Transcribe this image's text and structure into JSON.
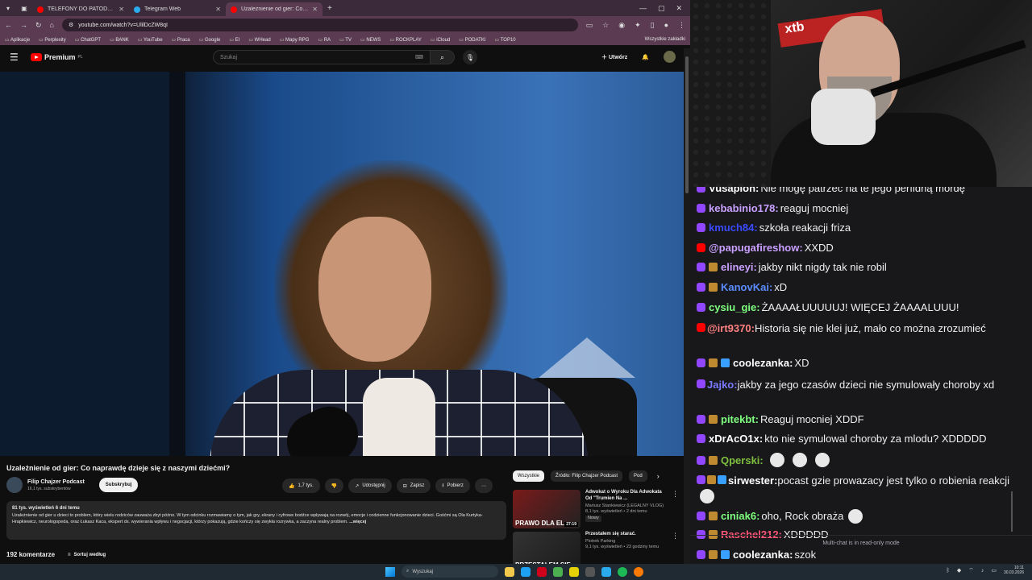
{
  "browser": {
    "tabs": [
      {
        "title": "TELEFONY DO PATODEWELOPE",
        "color": "#ff0000",
        "active": false
      },
      {
        "title": "Telegram Web",
        "color": "#2aabee",
        "active": false
      },
      {
        "title": "Uzależnienie od gier: Co naprawd",
        "color": "#ff0000",
        "active": true
      }
    ],
    "new_tab": "+",
    "url": "youtube.com/watch?v=UlilDcZW8qI",
    "bookmarks": [
      "Aplikacje",
      "Perplexity",
      "ChatGPT",
      "BANK",
      "YouTube",
      "Praca",
      "Google",
      "EI",
      "WHead",
      "Mapy RPG",
      "RA",
      "TV",
      "NEWS",
      "ROCKPLAY",
      "iCloud",
      "PODATKI",
      "TOP10"
    ],
    "all_bookmarks": "Wszystkie zakładki"
  },
  "youtube": {
    "logo": "Premium",
    "logo_sup": "PL",
    "search_placeholder": "Szukaj",
    "create_label": "Utwórz",
    "video_title": "Uzależnienie od gier: Co naprawdę dzieje się z naszymi dziećmi?",
    "channel_name": "Filip Chajzer Podcast",
    "channel_subs": "16,1 tys. subskrybentów",
    "subscribe_label": "Subskrybuj",
    "likes": "1,7 tys.",
    "share_label": "Udostępnij",
    "save_label": "Zapisz",
    "download_label": "Pobierz",
    "desc_meta": "81 tys. wyświetleń  6 dni temu",
    "desc_text": "Uzależnienie od gier u dzieci to problem, który wielu rodziców zauważa zbyt późno. W tym odcinku rozmawiamy o tym, jak gry, ekrany i cyfrowe bodźce wpływają na rozwój, emocje i codzienne funkcjonowanie dzieci. Gośćmi są Ola Kurtyka-Hrapkiewicz, neurologopeda, oraz Łukasz Kaca, ekspert ds. wywierania wpływu i negocjacji, którzy pokazują, gdzie kończy się zwykła rozrywka, a zaczyna realny problem.",
    "desc_more": "...więcej",
    "comments_count": "192 komentarze",
    "sort_label": "Sortuj według",
    "chips": [
      "Wszystkie",
      "Źródło: Filip Chajzer Podcast",
      "Pod"
    ],
    "related": [
      {
        "title": "Adwokat o Wyroku Dla Adwokata Od \"Trumien Na ...",
        "channel": "Mariusz Stankiewicz (LEGALNY VLOG)",
        "meta": "8,1 tys. wyświetleń • 2 dni temu",
        "badge": "Nowy",
        "thumb_text": "PRAWO DLA EL",
        "thumb_time": "27:19"
      },
      {
        "title": "Przestałem się starać.",
        "channel": "Piotrek Parking",
        "meta": "9,1 tys. wyświetleń • 23 godziny temu",
        "badge": "",
        "thumb_text": "PRZESTAŁEM SIĘ",
        "thumb_time": ""
      }
    ]
  },
  "chat": {
    "messages": [
      {
        "platform": "tw",
        "user": "Vusapion:",
        "color": "#ffffff",
        "text": "Nie mogę patrzeć na te jego perfidną mordę",
        "badges": 0,
        "emotes": 0
      },
      {
        "platform": "tw",
        "user": "kebabinio178:",
        "color": "#c9a0ff",
        "text": "reaguj mocniej",
        "badges": 0,
        "emotes": 0
      },
      {
        "platform": "tw",
        "user": "kmuch84:",
        "color": "#3a4bff",
        "text": "szkoła reakacji friza",
        "badges": 0,
        "emotes": 0
      },
      {
        "platform": "yt",
        "user": "@papugafireshow:",
        "color": "#c9a0ff",
        "text": "XXDD",
        "badges": 0,
        "emotes": 0
      },
      {
        "platform": "tw",
        "user": "elineyi:",
        "color": "#c9a0ff",
        "text": "jakby nikt nigdy tak nie robil",
        "badges": 1,
        "emotes": 0
      },
      {
        "platform": "tw",
        "user": "KanovKai:",
        "color": "#5b8cff",
        "text": "xD",
        "badges": 1,
        "emotes": 0
      },
      {
        "platform": "tw",
        "user": "cysiu_gie:",
        "color": "#7fff7f",
        "text": "ŻAAAAŁUUUUUJ! WIĘCEJ ŻAAAALUUU!",
        "badges": 0,
        "emotes": 0
      },
      {
        "platform": "yt",
        "user": "@irt9370:",
        "color": "#ff8080",
        "text": "Historia się nie klei już, mało co można zrozumieć",
        "badges": 0,
        "emotes": 0
      },
      {
        "platform": "tw",
        "user": "coolezanka:",
        "color": "#ffffff",
        "text": "XD",
        "badges": 2,
        "emotes": 0
      },
      {
        "platform": "tw",
        "user": "Jajko:",
        "color": "#7a7aff",
        "text": "jakby za jego czasów dzieci nie symulowały choroby xd",
        "badges": 0,
        "emotes": 0
      },
      {
        "platform": "tw",
        "user": "pitekbt:",
        "color": "#7fff7f",
        "text": "Reaguj mocniej XDDF",
        "badges": 1,
        "emotes": 0
      },
      {
        "platform": "tw",
        "user": "xDrAcO1x:",
        "color": "#ffffff",
        "text": "kto nie symulowal choroby za mlodu? XDDDDD",
        "badges": 0,
        "emotes": 0
      },
      {
        "platform": "tw",
        "user": "Qperski:",
        "color": "#7fbf3f",
        "text": "",
        "badges": 1,
        "emotes": 3
      },
      {
        "platform": "tw",
        "user": "sirwester:",
        "color": "#ffffff",
        "text": "pocast gzie prowazacy jest tylko o robienia reakcji",
        "badges": 2,
        "emotes": 1
      },
      {
        "platform": "tw",
        "user": "ciniak6:",
        "color": "#7fff7f",
        "text": "oho, Rock obraża",
        "badges": 1,
        "emotes": 1
      },
      {
        "platform": "tw",
        "user": "Raschel212:",
        "color": "#ff5577",
        "text": "XDDDDD",
        "badges": 1,
        "emotes": 0
      },
      {
        "platform": "tw",
        "user": "coolezanka:",
        "color": "#ffffff",
        "text": "szok",
        "badges": 2,
        "emotes": 0
      }
    ],
    "footer": "Multi-chat is in read-only mode"
  },
  "taskbar": {
    "search_label": "Wyszukaj",
    "time": "10:11",
    "date": "30.03.2026"
  }
}
